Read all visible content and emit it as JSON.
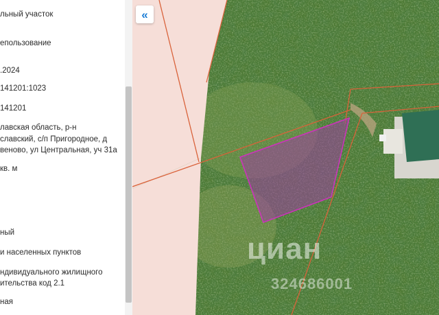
{
  "panel": {
    "rows": [
      "льный участок",
      "епользование",
      ".2024",
      "141201:1023",
      "141201",
      "лавская область, р-н",
      "славский, с/п Пригородное, д",
      "веново, ул Центральная, уч 31а",
      "кв. м",
      "ный",
      "и населенных пунктов",
      "ндивидуального жилищного",
      "ительства код 2.1",
      "ная"
    ]
  },
  "map": {
    "collapse_icon": "«",
    "watermark": {
      "logo": "циан",
      "id": "324686001"
    },
    "colors": {
      "parcel_border": "#cc33bb",
      "cadastral_lines": "#d9623a",
      "roof": "#2f6f55"
    }
  }
}
